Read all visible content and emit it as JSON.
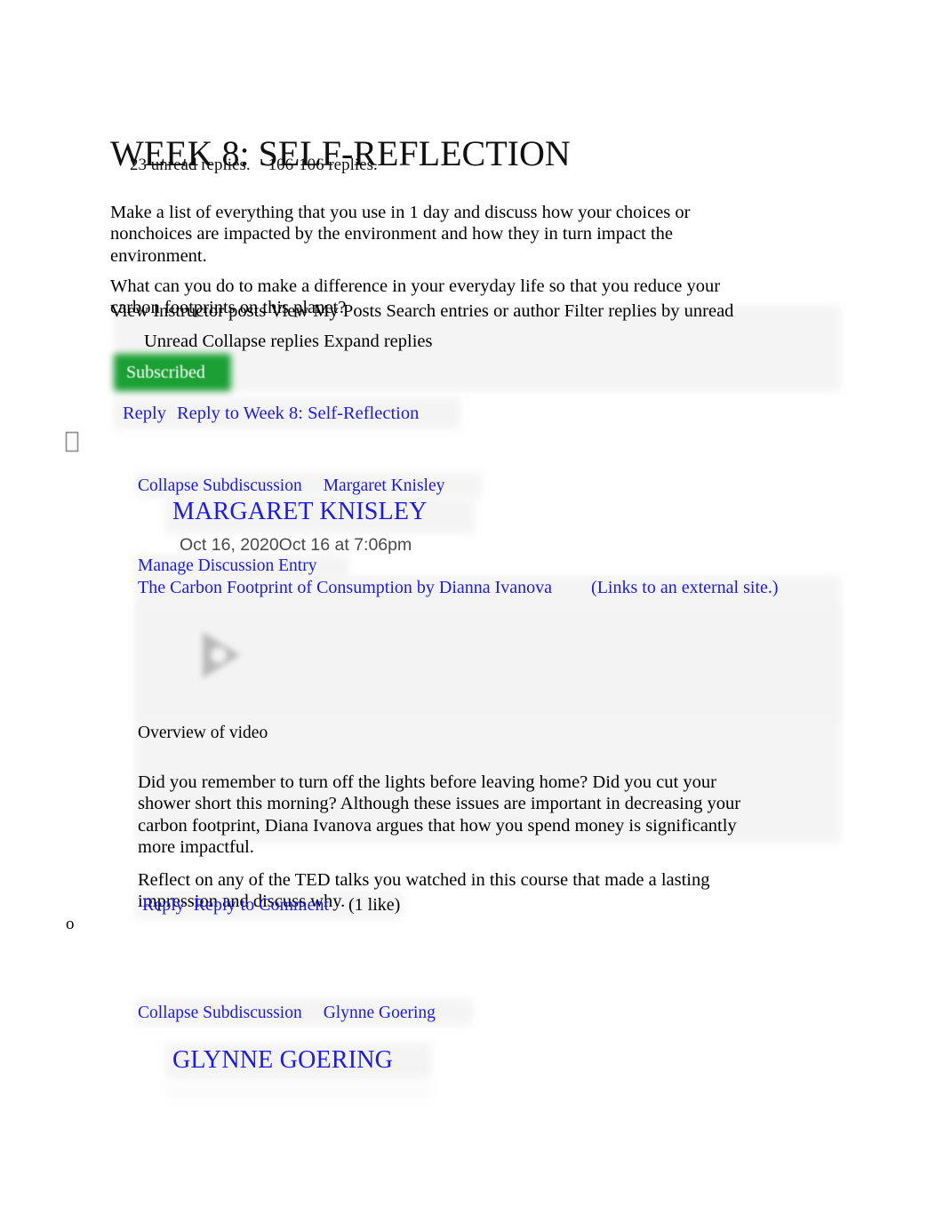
{
  "discussion": {
    "title": "WEEK 8: SELF-REFLECTION",
    "unread_count": "23 unread replies.",
    "replies_count_a": "106",
    "replies_count_b": "106 replies.",
    "prompt_paragraph_1": "Make a list of everything that you use in 1 day and discuss how your choices or nonchoices are impacted by the environment and how they in turn impact the environment.",
    "prompt_paragraph_2": "What can you do to make a difference in your everyday life so that you reduce your carbon footprints on this planet?"
  },
  "toolbar": {
    "view_instructor_posts": "View Instructor posts",
    "view_my_posts": "View My Posts",
    "search_entries": "Search entries or author",
    "filter_replies": "Filter replies by unread",
    "line_1": "View Instructor posts View My Posts Search entries or author Filter replies by unread",
    "unread": "Unread",
    "collapse_replies": "Collapse replies",
    "expand_replies": "Expand replies",
    "line_2": "Unread Collapse replies Expand replies",
    "subscribed_label": "Subscribed",
    "subscribed_color": "#1aa033"
  },
  "top_reply": {
    "reply_label": "Reply",
    "reply_to_label": "Reply to Week 8: Self-Reflection"
  },
  "entries": [
    {
      "collapse_label": "Collapse Subdiscussion",
      "author_link": "Margaret Knisley",
      "author_display": "MARGARET KNISLEY",
      "date": "Oct 16, 2020Oct 16 at 7:06pm",
      "manage_label": "Manage Discussion Entry",
      "resource_link": "The Carbon Footprint of Consumption by Dianna Ivanova",
      "external_note": "(Links to an external site.)",
      "overview_heading": "Overview of video",
      "body": "Did you remember to turn off the lights before leaving home? Did you cut your shower short this morning? Although these issues are important in decreasing your carbon footprint, Diana Ivanova argues that how you spend money is significantly more impactful.",
      "reflection": "Reflect on any of the TED talks you watched in this course that made a lasting impression and discuss why.",
      "reply_label": "Reply",
      "reply_to_comment_label": "Reply to Comment",
      "likes": "(1 like)",
      "bullet": "o"
    },
    {
      "collapse_label": "Collapse Subdiscussion",
      "author_link": "Glynne Goering",
      "author_display": "GLYNNE GOERING"
    }
  ],
  "colors": {
    "link": "#1a1aee",
    "text": "#000000",
    "date": "#4a4a4a",
    "panel": "#f4f4f4"
  }
}
